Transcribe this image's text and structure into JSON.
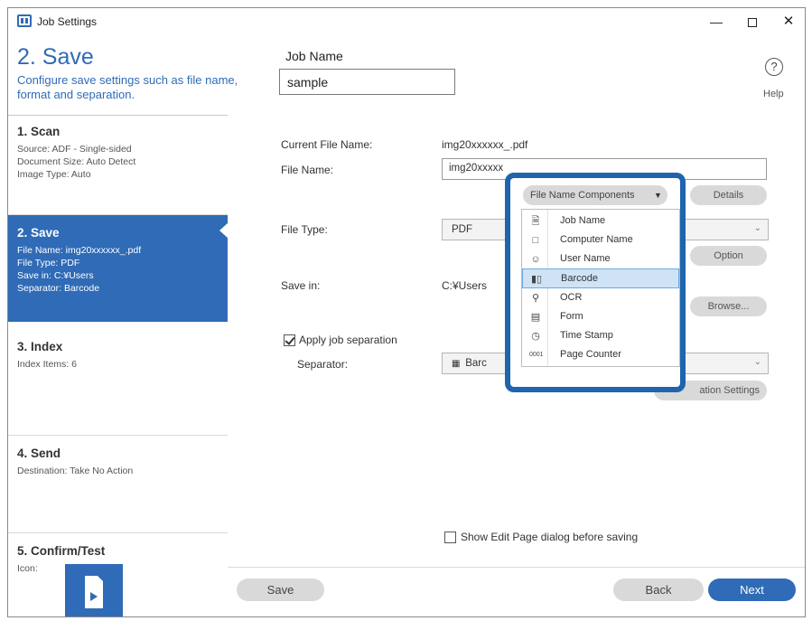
{
  "window": {
    "title": "Job Settings",
    "minimize": "—",
    "close": "✕"
  },
  "header": {
    "step_title": "2. Save",
    "description": "Configure save settings such as file name, format and separation.",
    "job_name_label": "Job Name",
    "job_name_value": "sample",
    "help_icon_glyph": "?",
    "help_label": "Help"
  },
  "sidebar": {
    "scan": {
      "title": "1. Scan",
      "lines": [
        "Source: ADF - Single-sided",
        "Document Size: Auto Detect",
        "Image Type: Auto"
      ]
    },
    "save": {
      "title": "2. Save",
      "lines": [
        "File Name: img20xxxxxx_.pdf",
        "File Type: PDF",
        "Save in: C:¥Users",
        "Separator: Barcode"
      ]
    },
    "index": {
      "title": "3. Index",
      "lines": [
        "Index Items: 6"
      ]
    },
    "send": {
      "title": "4. Send",
      "lines": [
        "Destination: Take No Action"
      ]
    },
    "confirm": {
      "title": "5. Confirm/Test",
      "lines": [
        "Icon:"
      ]
    }
  },
  "main": {
    "current_file_name_label": "Current File Name:",
    "current_file_name_value": "img20xxxxxx_.pdf",
    "file_name_label": "File Name:",
    "file_name_value": "img20xxxxx",
    "details_button": "Details",
    "file_type_label": "File Type:",
    "file_type_value": "PDF",
    "option_button": "Option",
    "save_in_label": "Save in:",
    "save_in_value": "C:¥Users",
    "browse_button": "Browse...",
    "apply_separation_label": "Apply job separation",
    "apply_separation_checked": true,
    "separator_label": "Separator:",
    "separator_value": "Barc",
    "separation_settings_button": "ation Settings",
    "show_edit_page_label": "Show Edit Page dialog before saving",
    "show_edit_page_checked": false
  },
  "popup": {
    "button_label": "File Name Components",
    "items": [
      {
        "label": "Job Name",
        "icon": "document-icon"
      },
      {
        "label": "Computer Name",
        "icon": "computer-icon"
      },
      {
        "label": "User Name",
        "icon": "user-icon"
      },
      {
        "label": "Barcode",
        "icon": "barcode-icon",
        "selected": true
      },
      {
        "label": "OCR",
        "icon": "ocr-icon"
      },
      {
        "label": "Form",
        "icon": "form-icon"
      },
      {
        "label": "Time Stamp",
        "icon": "time-stamp-icon"
      },
      {
        "label": "Page Counter",
        "icon": "page-counter-icon"
      }
    ]
  },
  "footer": {
    "save_button": "Save",
    "back_button": "Back",
    "next_button": "Next"
  },
  "colors": {
    "accent": "#2f6bb6",
    "popup_border": "#1f64ad",
    "selected_item": "#cfe3f7"
  }
}
